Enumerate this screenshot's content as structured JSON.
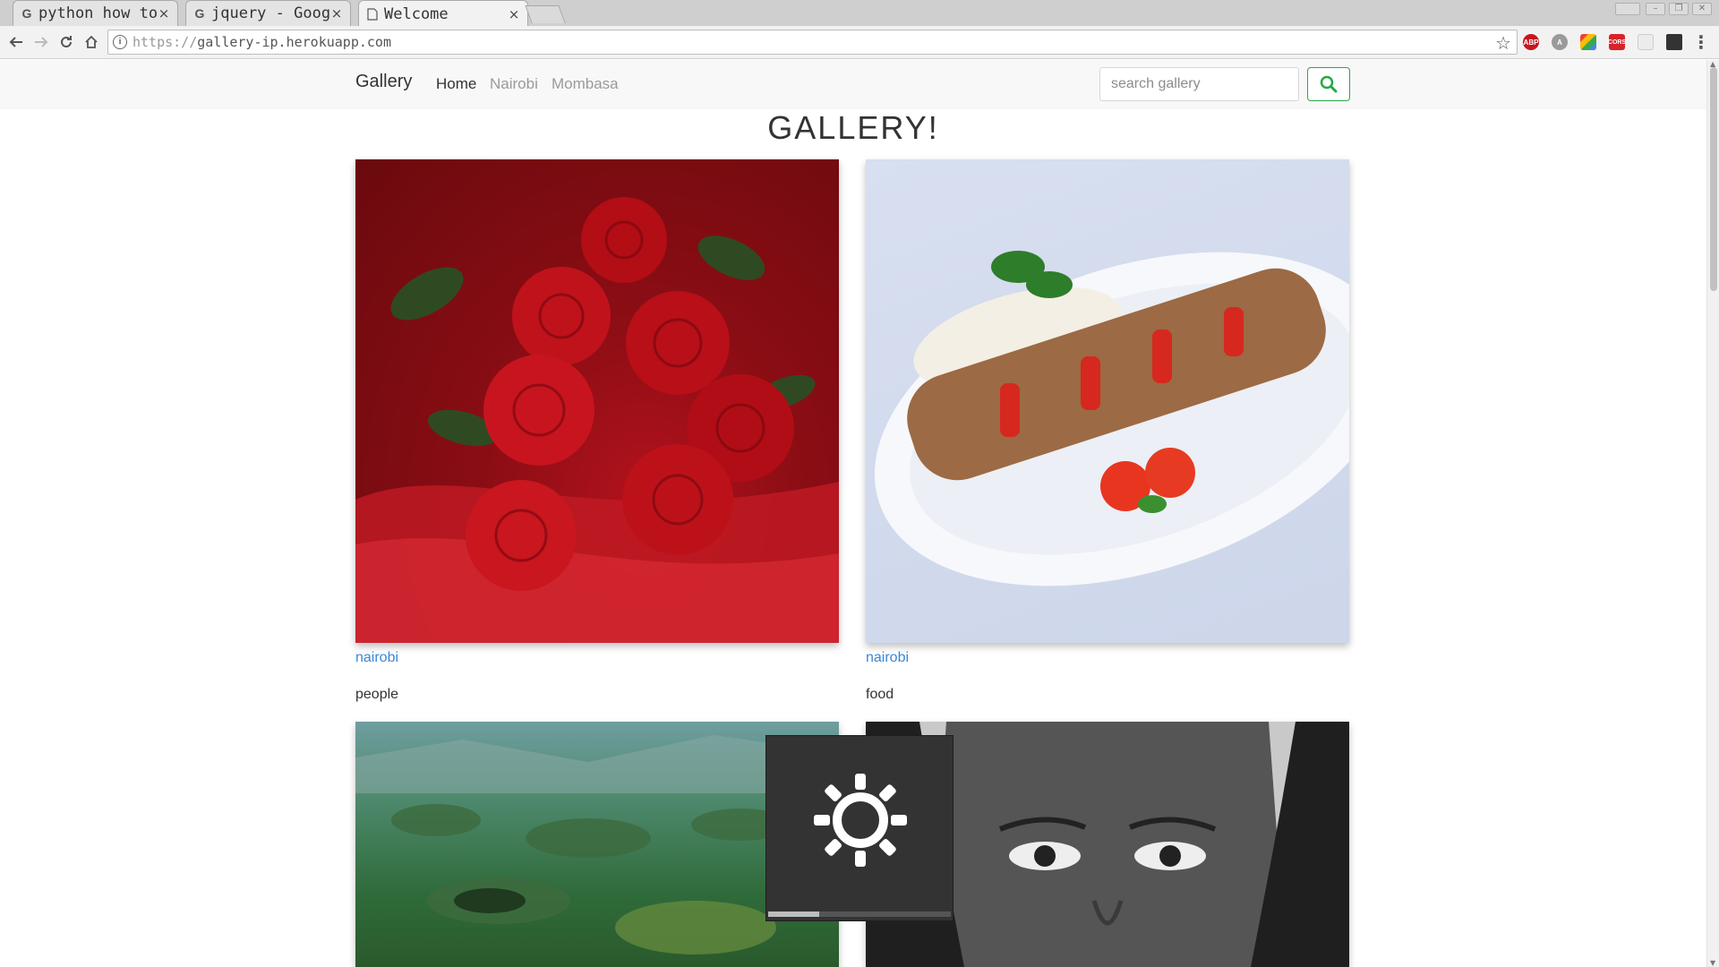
{
  "browser": {
    "tabs": [
      {
        "title": "python how to",
        "favicon": "G",
        "active": false
      },
      {
        "title": "jquery - Goog",
        "favicon": "G",
        "active": false
      },
      {
        "title": "Welcome",
        "favicon": "page-icon",
        "active": true
      }
    ],
    "tab_close": "×",
    "url_scheme": "https://",
    "url_host": "gallery-ip.herokuapp.com",
    "extensions": [
      "ABP",
      "A",
      "multi",
      "CORS",
      "plain",
      "dark"
    ]
  },
  "site": {
    "brand": "Gallery",
    "nav": [
      {
        "label": "Home",
        "active": true
      },
      {
        "label": "Nairobi",
        "active": false
      },
      {
        "label": "Mombasa",
        "active": false
      }
    ],
    "search_placeholder": "search gallery",
    "title": "GALLERY!"
  },
  "cards": [
    {
      "image": "red roses on satin",
      "location": "nairobi",
      "category": "people"
    },
    {
      "image": "kebab skewer with rice on plate",
      "location": "nairobi",
      "category": "food"
    },
    {
      "image": "aerial volcanic landscape",
      "location": "",
      "category": ""
    },
    {
      "image": "black and white portrait",
      "location": "",
      "category": ""
    }
  ],
  "osd": {
    "type": "brightness",
    "level": 0.28
  },
  "colors": {
    "link": "#3b86d4",
    "search_button": "#28a745",
    "navbar_bg": "#f8f8f9"
  }
}
